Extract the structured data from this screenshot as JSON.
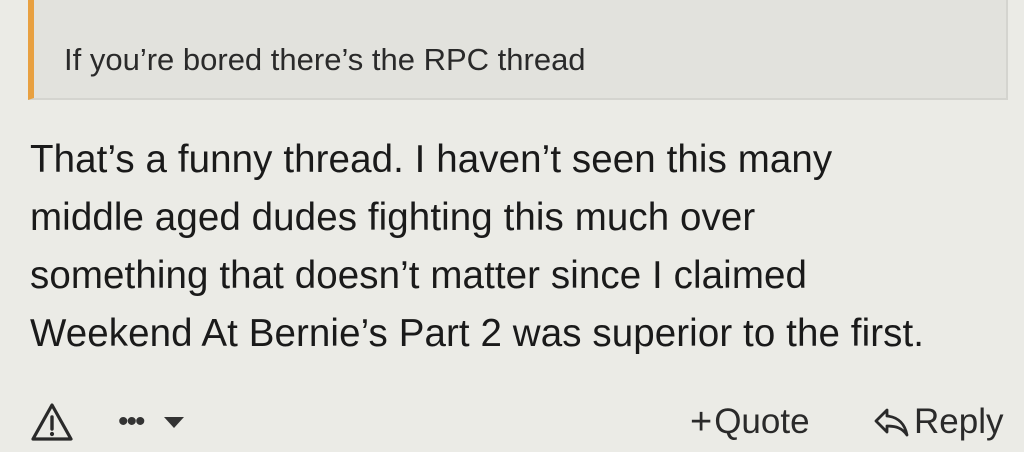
{
  "quote": {
    "text": "If you’re bored there’s the RPC thread",
    "accent_color": "#e8a040"
  },
  "post": {
    "lines": [
      "That’s a funny thread. I haven’t seen this many",
      "middle aged dudes fighting this much over",
      "something that doesn’t matter since I claimed",
      "Weekend At Bernie’s Part 2 was superior to the first."
    ]
  },
  "actions": {
    "report_icon": "warning-triangle-icon",
    "more_label": "•••",
    "more_icon": "chevron-down-icon",
    "quote_plus": "+",
    "quote_label": "Quote",
    "reply_icon": "reply-arrow-icon",
    "reply_label": "Reply"
  }
}
